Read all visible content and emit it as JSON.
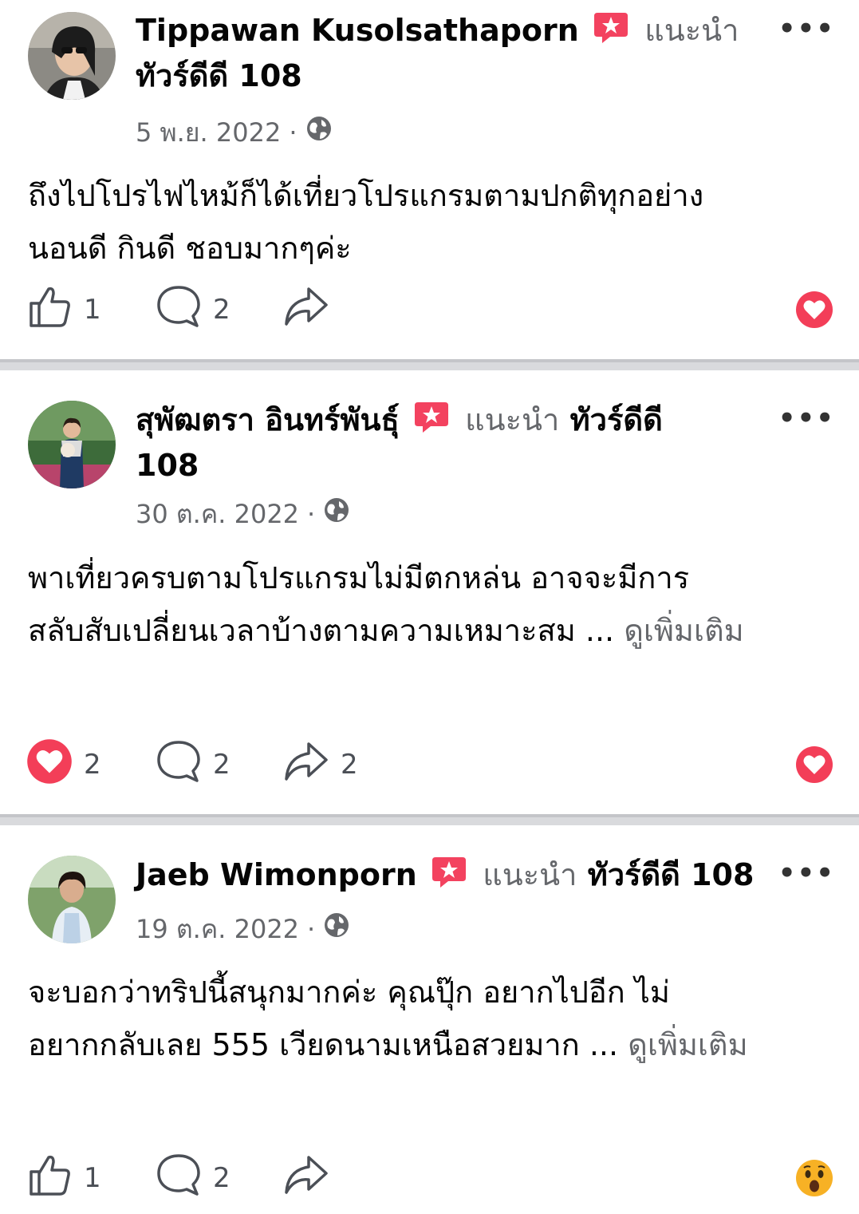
{
  "posts": [
    {
      "author": "Tippawan Kusolsathaporn",
      "recommends_label": "แนะนำ",
      "page_name": "ทัวร์ดีดี 108",
      "date": "5 พ.ย. 2022",
      "separator": "·",
      "text_line1": "ถึงไปโปรไฟไหม้ก็ได้เที่ยวโปรแกรมตามปกติทุกอย่าง",
      "text_line2": "นอนดี กินดี ชอบมากๆค่ะ",
      "see_more": "",
      "likes": "1",
      "comments": "2",
      "shares": "",
      "reaction_icon": "heart-icon"
    },
    {
      "author": "สุพัฒตรา อินทร์พันธุ์",
      "recommends_label": "แนะนำ",
      "page_name": "ทัวร์ดีดี",
      "page_name_line2": "108",
      "date": "30 ต.ค. 2022",
      "separator": "·",
      "text_line1": "พาเที่ยวครบตามโปรแกรมไม่มีตกหล่น อาจจะมีการ",
      "text_line2": "สลับสับเปลี่ยนเวลาบ้างตามความเหมาะสม ...",
      "see_more": "ดูเพิ่มเติม",
      "likes": "2",
      "comments": "2",
      "shares": "2",
      "reaction_icon": "heart-icon"
    },
    {
      "author": "Jaeb Wimonporn",
      "recommends_label": "แนะนำ",
      "page_name": "ทัวร์ดีดี 108",
      "date": "19 ต.ค. 2022",
      "separator": "·",
      "text_line1": "จะบอกว่าทริปนี้สนุกมากค่ะ คุณปุ๊ก อยากไปอีก ไม่",
      "text_line2": "อยากกลับเลย 555 เวียดนามเหนือสวยมาก ...",
      "see_more": "ดูเพิ่มเติม",
      "likes": "1",
      "comments": "2",
      "shares": "",
      "reaction_icon": "wow-icon"
    }
  ],
  "more_label": "•••",
  "colors": {
    "heart": "#f33e58",
    "recommend_badge": "#f3425f",
    "wow": "#f7b125",
    "secondary_text": "#65676b"
  }
}
